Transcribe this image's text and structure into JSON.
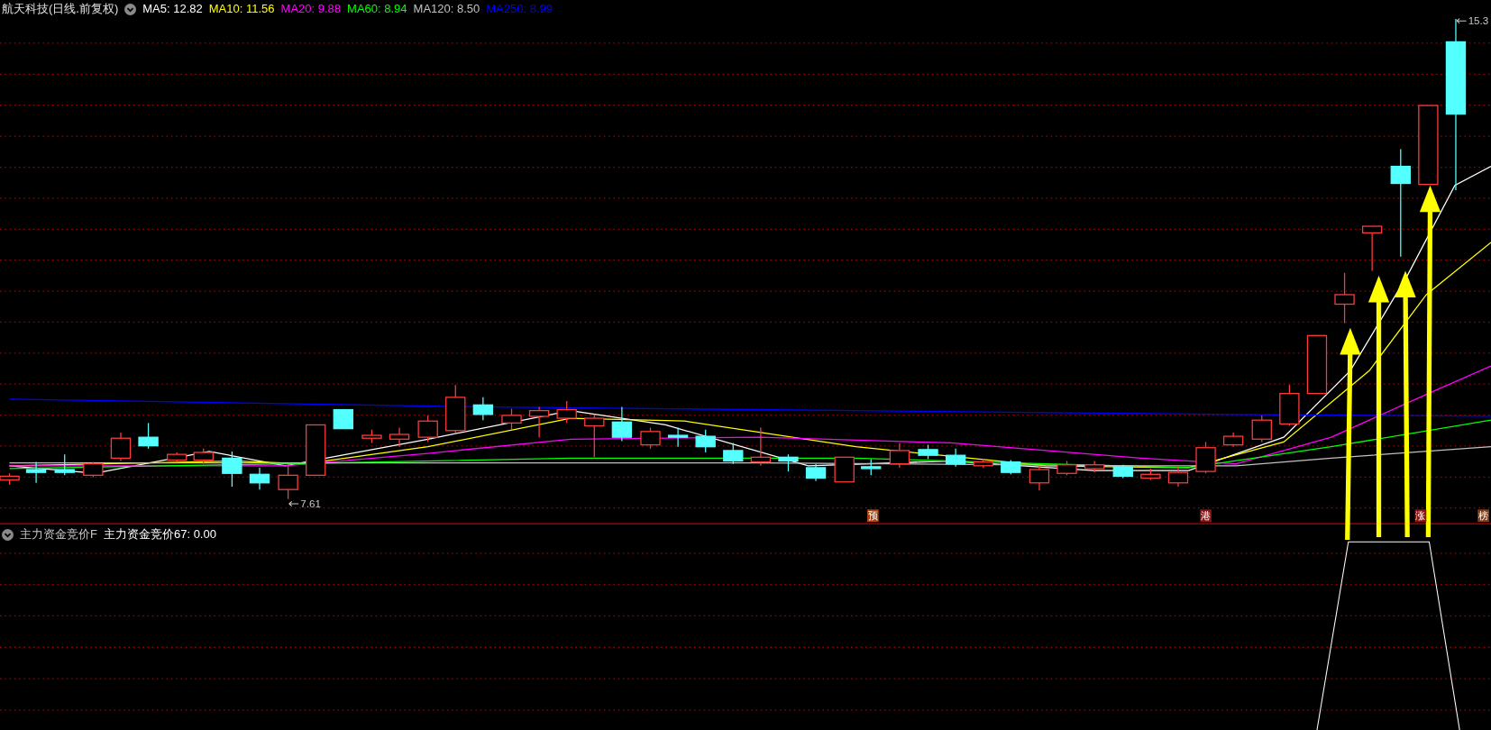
{
  "title": "航天科技(日线.前复权)",
  "moving_averages": [
    {
      "label": "MA5: 12.82",
      "color": "#ffffff"
    },
    {
      "label": "MA10: 11.56",
      "color": "#ffff00"
    },
    {
      "label": "MA20: 9.88",
      "color": "#ff00ff"
    },
    {
      "label": "MA60: 8.94",
      "color": "#00ff00"
    },
    {
      "label": "MA120: 8.50",
      "color": "#c0c0c0"
    },
    {
      "label": "MA250: 8.99",
      "color": "#0000ff"
    }
  ],
  "price_marks": [
    {
      "text": "15.3"
    },
    {
      "text": "7.61"
    }
  ],
  "signal_tags": [
    {
      "text": "预",
      "color": "#a8420e"
    },
    {
      "text": "港",
      "color": "#8a1414"
    },
    {
      "text": "涨",
      "color": "#8a1414"
    },
    {
      "text": "榜",
      "color": "#8a3c10"
    }
  ],
  "indicator": {
    "name": "主力资金竞价F",
    "value": "主力资金竞价67: 0.00"
  }
}
